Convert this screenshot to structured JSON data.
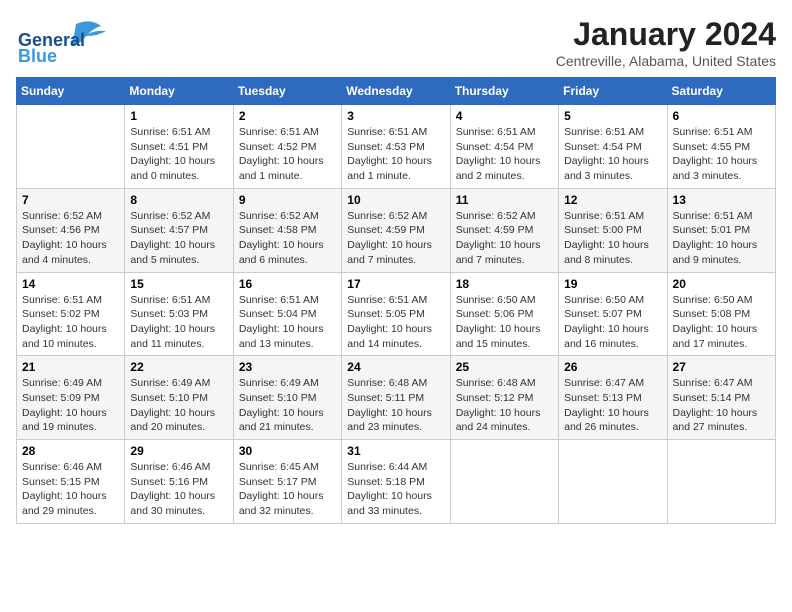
{
  "header": {
    "logo_general": "General",
    "logo_blue": "Blue",
    "month_title": "January 2024",
    "location": "Centreville, Alabama, United States"
  },
  "days_of_week": [
    "Sunday",
    "Monday",
    "Tuesday",
    "Wednesday",
    "Thursday",
    "Friday",
    "Saturday"
  ],
  "weeks": [
    [
      {
        "day": "",
        "info": ""
      },
      {
        "day": "1",
        "info": "Sunrise: 6:51 AM\nSunset: 4:51 PM\nDaylight: 10 hours\nand 0 minutes."
      },
      {
        "day": "2",
        "info": "Sunrise: 6:51 AM\nSunset: 4:52 PM\nDaylight: 10 hours\nand 1 minute."
      },
      {
        "day": "3",
        "info": "Sunrise: 6:51 AM\nSunset: 4:53 PM\nDaylight: 10 hours\nand 1 minute."
      },
      {
        "day": "4",
        "info": "Sunrise: 6:51 AM\nSunset: 4:54 PM\nDaylight: 10 hours\nand 2 minutes."
      },
      {
        "day": "5",
        "info": "Sunrise: 6:51 AM\nSunset: 4:54 PM\nDaylight: 10 hours\nand 3 minutes."
      },
      {
        "day": "6",
        "info": "Sunrise: 6:51 AM\nSunset: 4:55 PM\nDaylight: 10 hours\nand 3 minutes."
      }
    ],
    [
      {
        "day": "7",
        "info": "Sunrise: 6:52 AM\nSunset: 4:56 PM\nDaylight: 10 hours\nand 4 minutes."
      },
      {
        "day": "8",
        "info": "Sunrise: 6:52 AM\nSunset: 4:57 PM\nDaylight: 10 hours\nand 5 minutes."
      },
      {
        "day": "9",
        "info": "Sunrise: 6:52 AM\nSunset: 4:58 PM\nDaylight: 10 hours\nand 6 minutes."
      },
      {
        "day": "10",
        "info": "Sunrise: 6:52 AM\nSunset: 4:59 PM\nDaylight: 10 hours\nand 7 minutes."
      },
      {
        "day": "11",
        "info": "Sunrise: 6:52 AM\nSunset: 4:59 PM\nDaylight: 10 hours\nand 7 minutes."
      },
      {
        "day": "12",
        "info": "Sunrise: 6:51 AM\nSunset: 5:00 PM\nDaylight: 10 hours\nand 8 minutes."
      },
      {
        "day": "13",
        "info": "Sunrise: 6:51 AM\nSunset: 5:01 PM\nDaylight: 10 hours\nand 9 minutes."
      }
    ],
    [
      {
        "day": "14",
        "info": "Sunrise: 6:51 AM\nSunset: 5:02 PM\nDaylight: 10 hours\nand 10 minutes."
      },
      {
        "day": "15",
        "info": "Sunrise: 6:51 AM\nSunset: 5:03 PM\nDaylight: 10 hours\nand 11 minutes."
      },
      {
        "day": "16",
        "info": "Sunrise: 6:51 AM\nSunset: 5:04 PM\nDaylight: 10 hours\nand 13 minutes."
      },
      {
        "day": "17",
        "info": "Sunrise: 6:51 AM\nSunset: 5:05 PM\nDaylight: 10 hours\nand 14 minutes."
      },
      {
        "day": "18",
        "info": "Sunrise: 6:50 AM\nSunset: 5:06 PM\nDaylight: 10 hours\nand 15 minutes."
      },
      {
        "day": "19",
        "info": "Sunrise: 6:50 AM\nSunset: 5:07 PM\nDaylight: 10 hours\nand 16 minutes."
      },
      {
        "day": "20",
        "info": "Sunrise: 6:50 AM\nSunset: 5:08 PM\nDaylight: 10 hours\nand 17 minutes."
      }
    ],
    [
      {
        "day": "21",
        "info": "Sunrise: 6:49 AM\nSunset: 5:09 PM\nDaylight: 10 hours\nand 19 minutes."
      },
      {
        "day": "22",
        "info": "Sunrise: 6:49 AM\nSunset: 5:10 PM\nDaylight: 10 hours\nand 20 minutes."
      },
      {
        "day": "23",
        "info": "Sunrise: 6:49 AM\nSunset: 5:10 PM\nDaylight: 10 hours\nand 21 minutes."
      },
      {
        "day": "24",
        "info": "Sunrise: 6:48 AM\nSunset: 5:11 PM\nDaylight: 10 hours\nand 23 minutes."
      },
      {
        "day": "25",
        "info": "Sunrise: 6:48 AM\nSunset: 5:12 PM\nDaylight: 10 hours\nand 24 minutes."
      },
      {
        "day": "26",
        "info": "Sunrise: 6:47 AM\nSunset: 5:13 PM\nDaylight: 10 hours\nand 26 minutes."
      },
      {
        "day": "27",
        "info": "Sunrise: 6:47 AM\nSunset: 5:14 PM\nDaylight: 10 hours\nand 27 minutes."
      }
    ],
    [
      {
        "day": "28",
        "info": "Sunrise: 6:46 AM\nSunset: 5:15 PM\nDaylight: 10 hours\nand 29 minutes."
      },
      {
        "day": "29",
        "info": "Sunrise: 6:46 AM\nSunset: 5:16 PM\nDaylight: 10 hours\nand 30 minutes."
      },
      {
        "day": "30",
        "info": "Sunrise: 6:45 AM\nSunset: 5:17 PM\nDaylight: 10 hours\nand 32 minutes."
      },
      {
        "day": "31",
        "info": "Sunrise: 6:44 AM\nSunset: 5:18 PM\nDaylight: 10 hours\nand 33 minutes."
      },
      {
        "day": "",
        "info": ""
      },
      {
        "day": "",
        "info": ""
      },
      {
        "day": "",
        "info": ""
      }
    ]
  ]
}
